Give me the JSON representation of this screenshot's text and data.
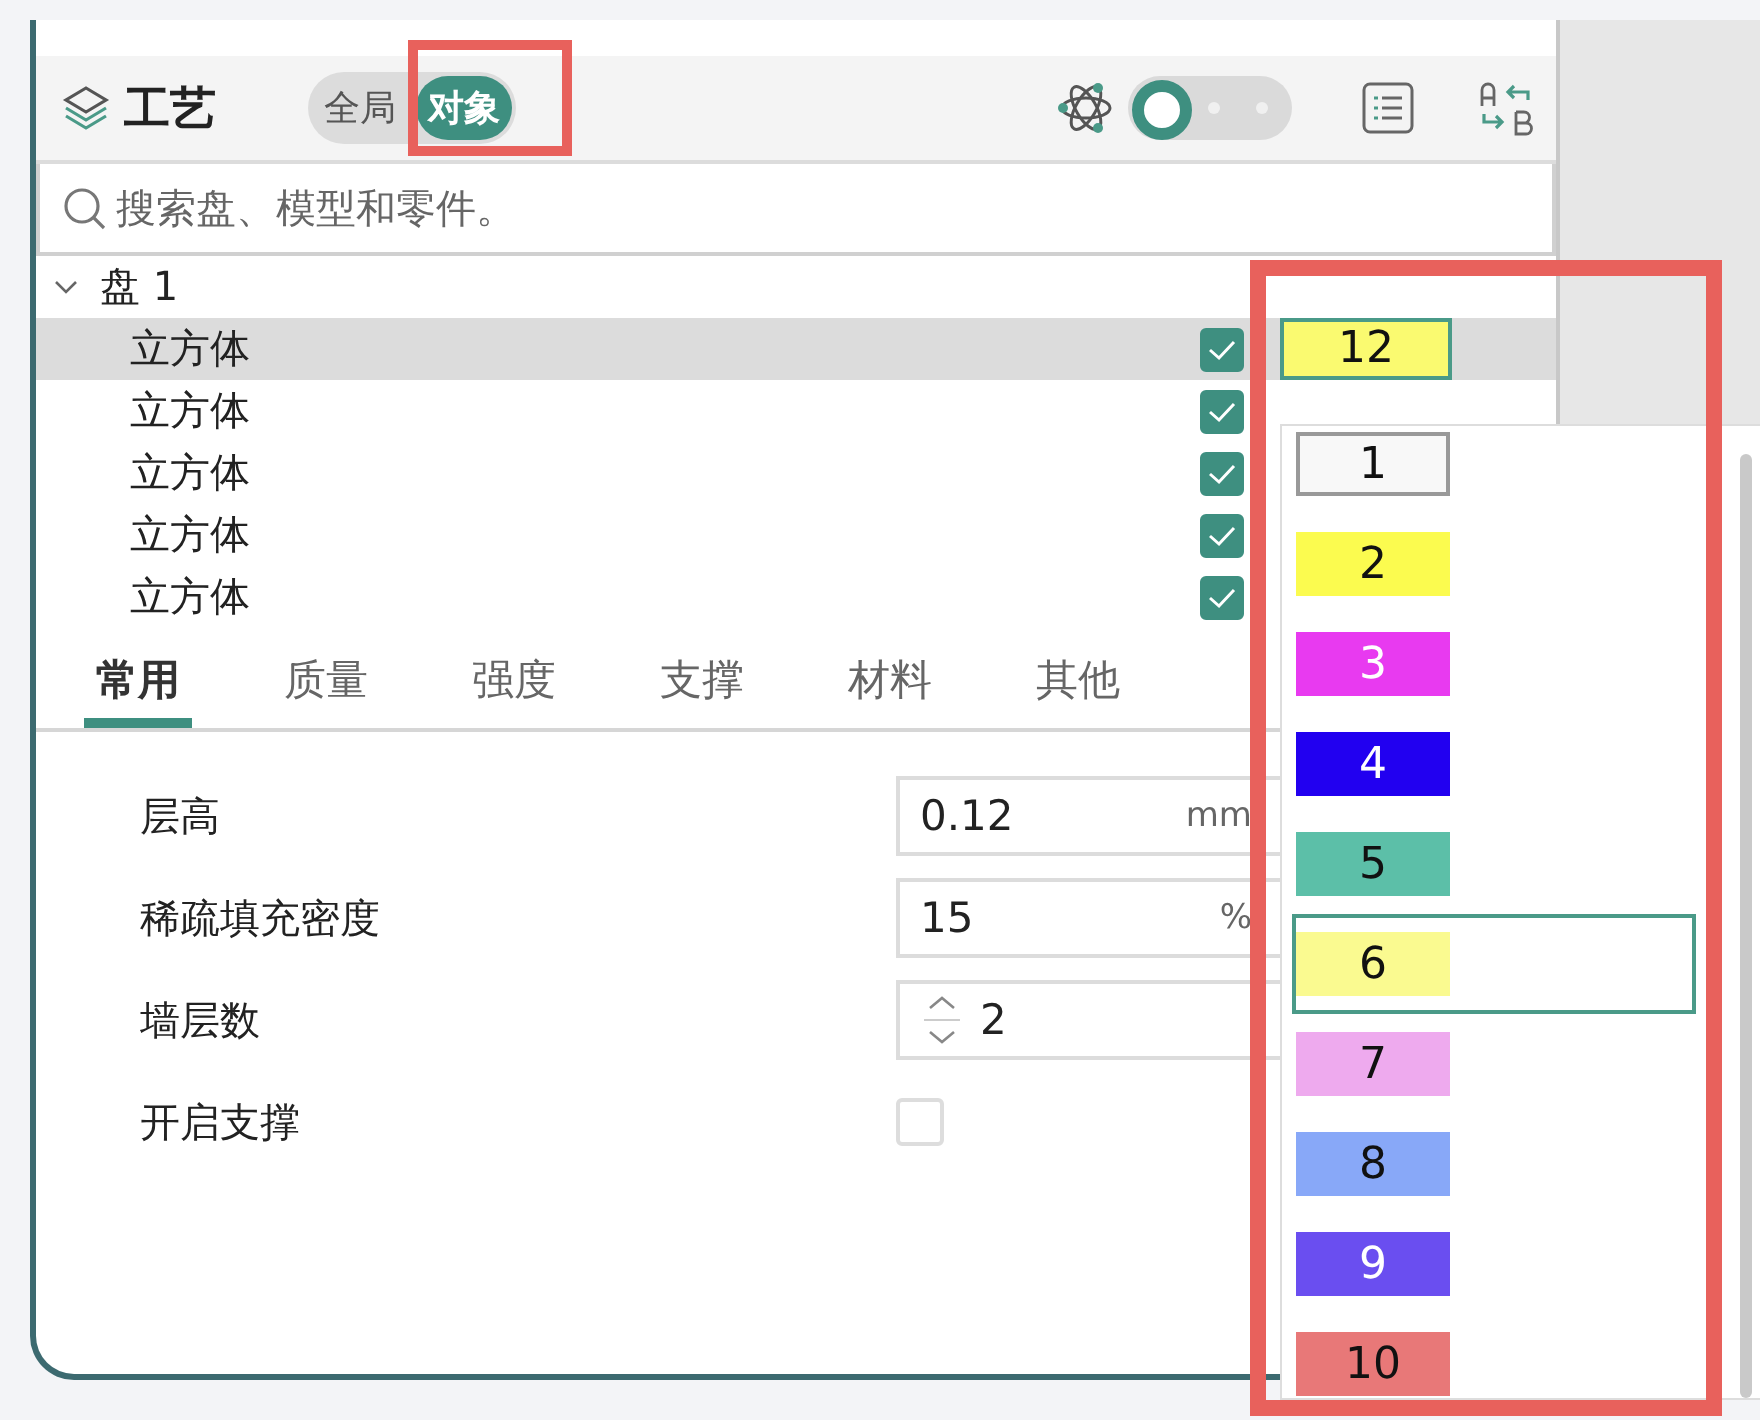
{
  "header": {
    "title": "工艺",
    "scope_toggle": [
      {
        "label": "全局",
        "selected": false
      },
      {
        "label": "对象",
        "selected": true
      }
    ],
    "mode_switch": {
      "on": false
    }
  },
  "search": {
    "placeholder": "搜索盘、模型和零件。"
  },
  "tree": [
    {
      "label": "盘 1",
      "expanded": true,
      "children": [
        {
          "label": "立方体",
          "selected": true,
          "checked": true,
          "chip": {
            "label": "12",
            "color": "#fafa70"
          }
        },
        {
          "label": "立方体",
          "selected": false,
          "checked": true
        },
        {
          "label": "立方体",
          "selected": false,
          "checked": true
        },
        {
          "label": "立方体",
          "selected": false,
          "checked": true
        },
        {
          "label": "立方体",
          "selected": false,
          "checked": true
        }
      ]
    }
  ],
  "color_dropdown": {
    "items": [
      {
        "label": "1",
        "color": "#f8f8f8",
        "hovered": false
      },
      {
        "label": "2",
        "color": "#fbfb4f",
        "hovered": false
      },
      {
        "label": "3",
        "color": "#e83af0",
        "hovered": false
      },
      {
        "label": "4",
        "color": "#2200f0",
        "hovered": false
      },
      {
        "label": "5",
        "color": "#5cbfa8",
        "hovered": false
      },
      {
        "label": "6",
        "color": "#fafa90",
        "hovered": true
      },
      {
        "label": "7",
        "color": "#eeaaee",
        "hovered": false
      },
      {
        "label": "8",
        "color": "#88a8f8",
        "hovered": false
      },
      {
        "label": "9",
        "color": "#6a4ef0",
        "hovered": false
      },
      {
        "label": "10",
        "color": "#e87878",
        "hovered": false
      }
    ]
  },
  "tabs": [
    {
      "label": "常用",
      "selected": true
    },
    {
      "label": "质量",
      "selected": false
    },
    {
      "label": "强度",
      "selected": false
    },
    {
      "label": "支撑",
      "selected": false
    },
    {
      "label": "材料",
      "selected": false
    },
    {
      "label": "其他",
      "selected": false
    }
  ],
  "settings": [
    {
      "kind": "text",
      "label": "层高",
      "value": "0.12",
      "unit": "mm"
    },
    {
      "kind": "text",
      "label": "稀疏填充密度",
      "value": "15",
      "unit": "%"
    },
    {
      "kind": "spin",
      "label": "墙层数",
      "value": "2"
    },
    {
      "kind": "checkbox",
      "label": "开启支撑",
      "checked": false
    }
  ]
}
